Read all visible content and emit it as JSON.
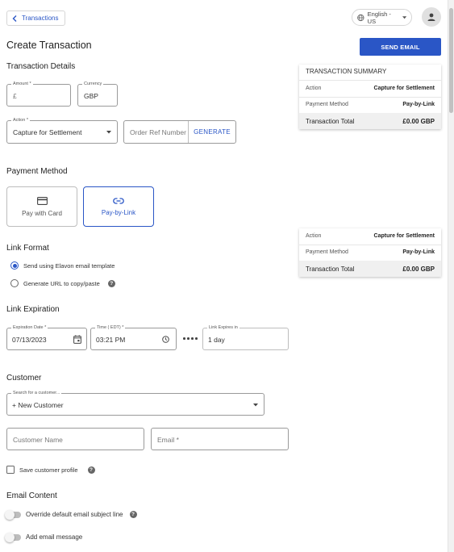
{
  "nav": {
    "back_label": "Transactions"
  },
  "language": {
    "selected": "English - US"
  },
  "page": {
    "title": "Create Transaction"
  },
  "actions": {
    "send_email_label": "SEND EMAIL"
  },
  "details": {
    "heading": "Transaction Details",
    "amount": {
      "label": "Amount *",
      "prefix": "£",
      "value": ""
    },
    "currency": {
      "label": "Currency",
      "value": "GBP"
    },
    "action": {
      "label": "Action *",
      "value": "Capture for Settlement"
    },
    "order_ref": {
      "placeholder": "Order Ref Number",
      "generate_label": "GENERATE"
    }
  },
  "summary": {
    "title": "TRANSACTION SUMMARY",
    "rows": [
      {
        "label": "Action",
        "value": "Capture for Settlement"
      },
      {
        "label": "Payment Method",
        "value": "Pay-by-Link"
      }
    ],
    "total": {
      "label": "Transaction Total",
      "value": "£0.00 GBP"
    }
  },
  "payment": {
    "heading": "Payment Method",
    "options": [
      {
        "label": "Pay with Card",
        "icon": "credit-card-icon",
        "selected": false
      },
      {
        "label": "Pay-by-Link",
        "icon": "link-icon",
        "selected": true
      }
    ]
  },
  "link_format": {
    "heading": "Link Format",
    "options": [
      {
        "label": "Send using Elavon email template",
        "selected": true
      },
      {
        "label": "Generate URL to copy/paste",
        "selected": false
      }
    ]
  },
  "expiration": {
    "heading": "Link Expiration",
    "date": {
      "label": "Expiration Date *",
      "value": "07/13/2023"
    },
    "time": {
      "label": "Time ( EDT) *",
      "value": "03:21 PM"
    },
    "expires_in": {
      "label": "Link Expires in",
      "value": "1 day"
    }
  },
  "customer": {
    "heading": "Customer",
    "search": {
      "label": "Search for a customer...",
      "value": "+ New Customer"
    },
    "name": {
      "placeholder": "Customer Name"
    },
    "email": {
      "placeholder": "Email *"
    },
    "save_profile": {
      "label": "Save customer profile",
      "checked": false
    }
  },
  "email_content": {
    "heading": "Email Content",
    "toggles": [
      {
        "label": "Override default email subject line",
        "on": false
      },
      {
        "label": "Add email message",
        "on": false
      }
    ]
  },
  "colors": {
    "primary": "#2a56c6",
    "border": "#9a9a9a"
  }
}
